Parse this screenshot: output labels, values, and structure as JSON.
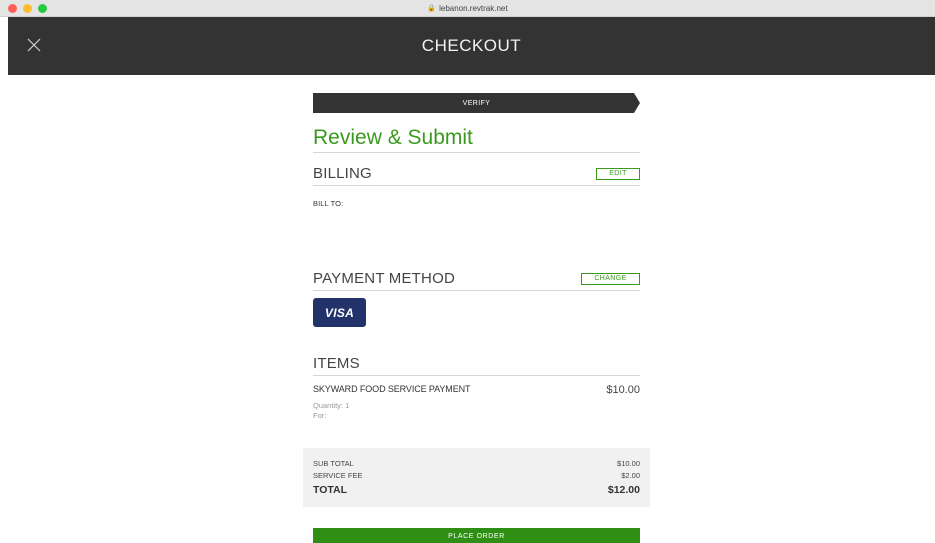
{
  "browser": {
    "url": "lebanon.revtrak.net",
    "lock_icon": "lock-icon"
  },
  "header": {
    "title": "CHECKOUT",
    "close_icon": "close-icon"
  },
  "progress": {
    "step_label": "VERIFY"
  },
  "review": {
    "title": "Review & Submit"
  },
  "billing": {
    "title": "BILLING",
    "edit_label": "EDIT",
    "bill_to_label": "BILL TO:"
  },
  "payment": {
    "title": "PAYMENT METHOD",
    "change_label": "CHANGE",
    "card_brand": "VISA"
  },
  "items": {
    "title": "ITEMS",
    "list": [
      {
        "name": "SKYWARD FOOD SERVICE PAYMENT",
        "price": "$10.00",
        "quantity": "Quantity: 1",
        "for": "For:"
      }
    ]
  },
  "totals": {
    "subtotal_label": "SUB TOTAL",
    "subtotal_value": "$10.00",
    "fee_label": "SERVICE FEE",
    "fee_value": "$2.00",
    "total_label": "TOTAL",
    "total_value": "$12.00"
  },
  "actions": {
    "place_order_label": "PLACE ORDER"
  },
  "colors": {
    "accent_green": "#3a9a1d",
    "button_green": "#2f8f14",
    "header_dark": "#333333",
    "visa_blue": "#22336b"
  }
}
